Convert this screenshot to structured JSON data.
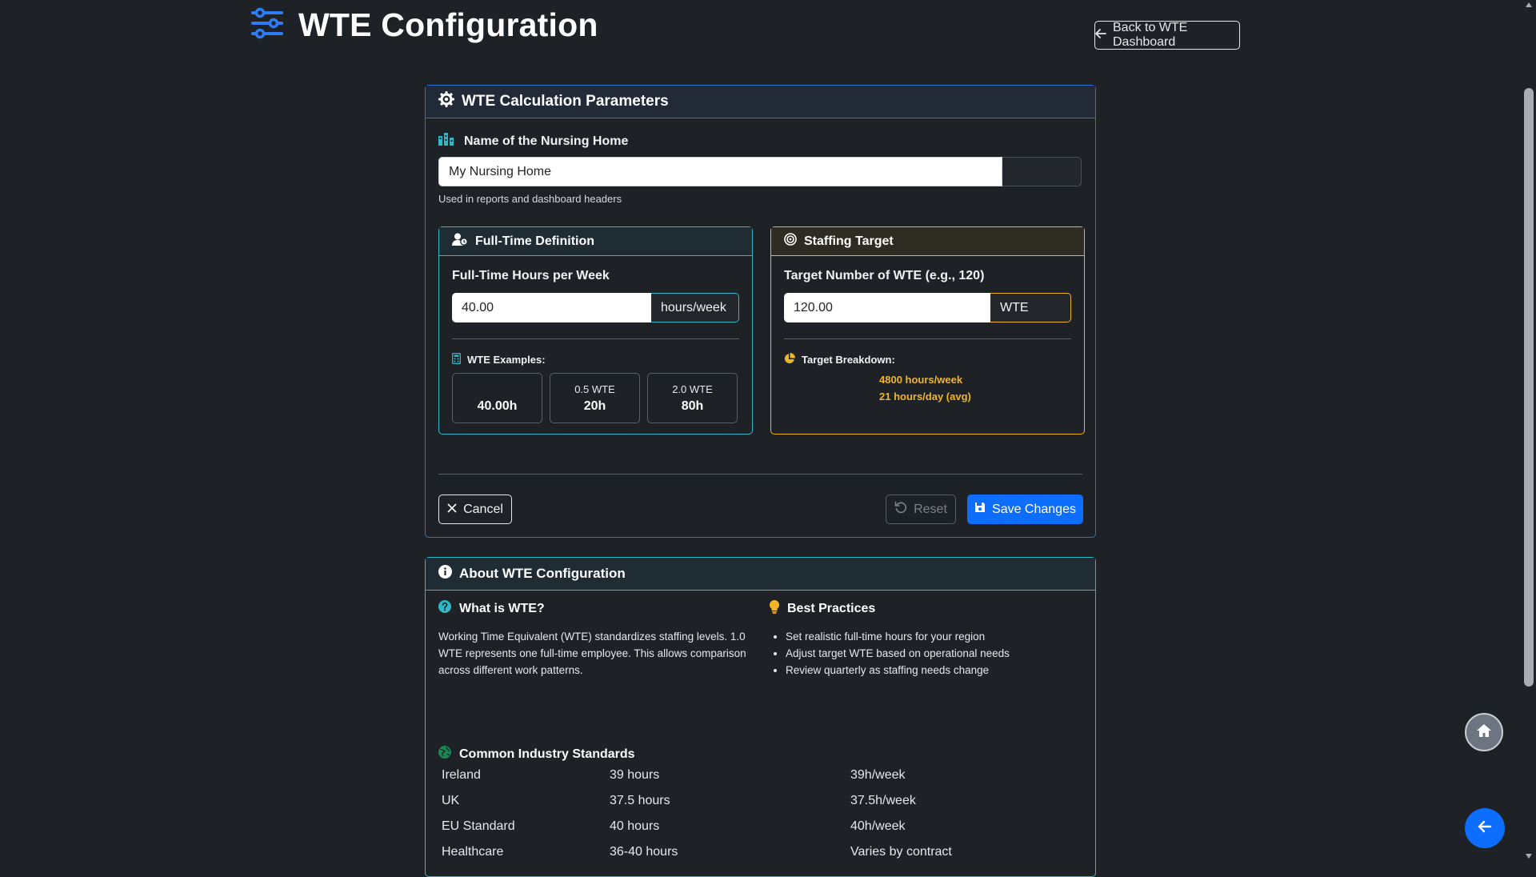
{
  "header": {
    "title": "WTE Configuration",
    "icon": "sliders-icon",
    "back_label": "Back to WTE Dashboard"
  },
  "params": {
    "title": "WTE Calculation Parameters",
    "name_label": "Name of the Nursing Home",
    "name_value": "My Nursing Home",
    "name_help": "Used in reports and dashboard headers",
    "fulltime": {
      "title": "Full-Time Definition",
      "hours_label": "Full-Time Hours per Week",
      "hours_value": "40.00",
      "hours_unit": "hours/week",
      "examples_label": "WTE Examples:",
      "examples": [
        {
          "label": "",
          "value": "40.00h"
        },
        {
          "label": "0.5 WTE",
          "value": "20h"
        },
        {
          "label": "2.0 WTE",
          "value": "80h"
        }
      ]
    },
    "staffing": {
      "title": "Staffing Target",
      "target_label": "Target Number of WTE (e.g., 120)",
      "target_value": "120.00",
      "target_unit": "WTE",
      "breakdown_label": "Target Breakdown:",
      "breakdown_weekly": "4800 hours/week",
      "breakdown_daily": "21 hours/day (avg)"
    },
    "buttons": {
      "cancel": "Cancel",
      "reset": "Reset",
      "save": "Save Changes"
    }
  },
  "about": {
    "title": "About WTE Configuration",
    "what_title": "What is WTE?",
    "what_text": "Working Time Equivalent (WTE) standardizes staffing levels. 1.0 WTE represents one full-time employee. This allows comparison across different work patterns.",
    "bp_title": "Best Practices",
    "bp_items": [
      "Set realistic full-time hours for your region",
      "Adjust target WTE based on operational needs",
      "Review quarterly as staffing needs change"
    ],
    "standards_title": "Common Industry Standards",
    "standards": [
      {
        "region": "Ireland",
        "hours": "39 hours",
        "per_week": "39h/week"
      },
      {
        "region": "UK",
        "hours": "37.5 hours",
        "per_week": "37.5h/week"
      },
      {
        "region": "EU Standard",
        "hours": "40 hours",
        "per_week": "40h/week"
      },
      {
        "region": "Healthcare",
        "hours": "36-40 hours",
        "per_week": "Varies by contract"
      }
    ]
  },
  "colors": {
    "primary": "#0d6efd",
    "info": "#2fb8c7",
    "warning": "#f0b429",
    "background": "#1e2227"
  }
}
